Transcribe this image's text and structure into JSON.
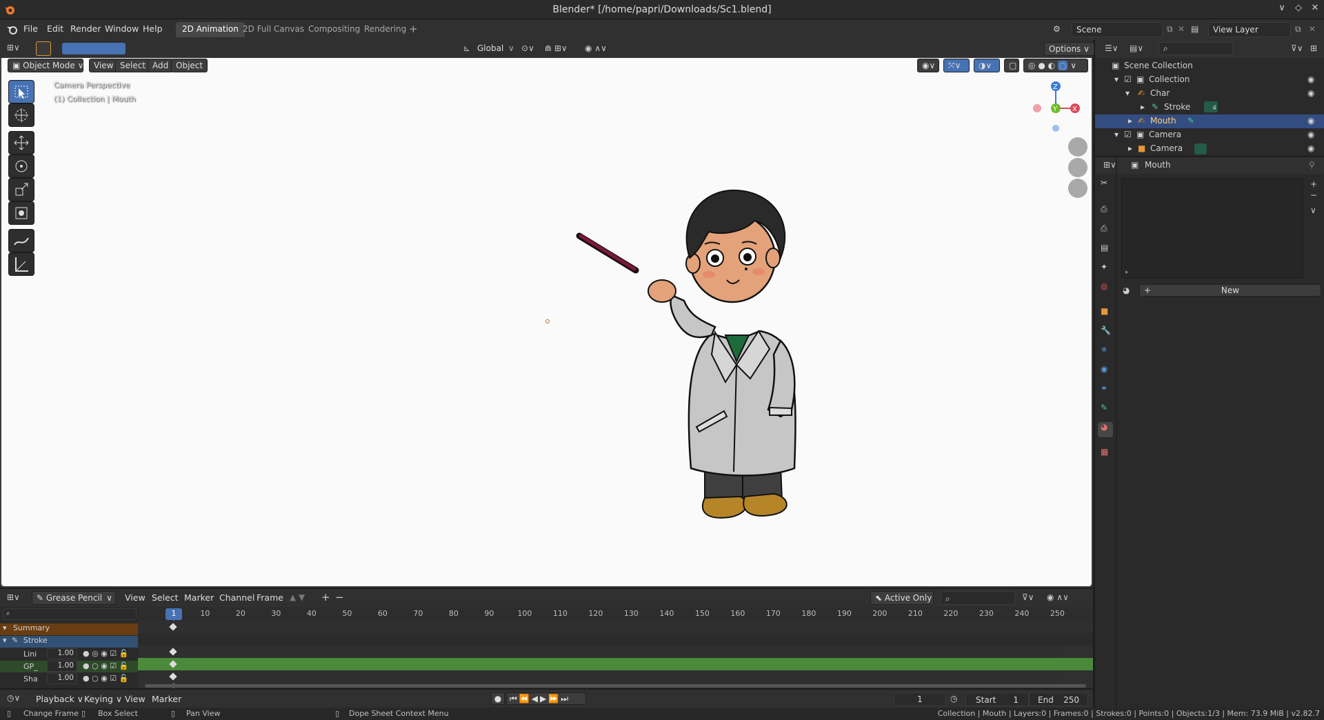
{
  "window": {
    "title": "Blender* [/home/papri/Downloads/Sc1.blend]",
    "controls": [
      "∨",
      "◇",
      "✕"
    ]
  },
  "menubar": {
    "menus": [
      "File",
      "Edit",
      "Render",
      "Window",
      "Help"
    ],
    "workspaces": [
      "2D Animation",
      "2D Full Canvas",
      "Compositing",
      "Rendering"
    ],
    "add_workspace": "+",
    "scene": "Scene",
    "view_layer": "View Layer"
  },
  "header3d": {
    "transform_orientation": "Global",
    "options": "Options ∨"
  },
  "viewport_header": {
    "mode": "Object Mode",
    "menus": [
      "View",
      "Select",
      "Add",
      "Object"
    ]
  },
  "viewport": {
    "perspective": "Camera Perspective",
    "collection_info": "(1) Collection | Mouth",
    "gizmo_axes": {
      "z": "Z",
      "y": "Y",
      "x": "X"
    }
  },
  "dopesheet": {
    "mode": "Grease Pencil",
    "menus": [
      "View",
      "Select",
      "Marker",
      "Channel",
      "Frame"
    ],
    "active_only": "Active Only",
    "current_frame": "1",
    "ruler": [
      "10",
      "20",
      "30",
      "40",
      "50",
      "60",
      "70",
      "80",
      "90",
      "100",
      "110",
      "120",
      "130",
      "140",
      "150",
      "160",
      "170",
      "180",
      "190",
      "200",
      "210",
      "220",
      "230",
      "240",
      "250"
    ],
    "channels": [
      {
        "name": "Summary",
        "type": "summary"
      },
      {
        "name": "Stroke",
        "type": "object"
      },
      {
        "name": "Lini",
        "value": "1.00",
        "type": "layer"
      },
      {
        "name": "GP_",
        "value": "1.00",
        "type": "layer"
      },
      {
        "name": "Sha",
        "value": "1.00",
        "type": "layer"
      }
    ]
  },
  "timeline": {
    "menus": [
      "Playback ∨",
      "Keying ∨",
      "View",
      "Marker"
    ],
    "frame": "1",
    "start_label": "Start",
    "start": "1",
    "end_label": "End",
    "end": "250"
  },
  "outliner": {
    "items": [
      {
        "label": "Scene Collection",
        "level": 0
      },
      {
        "label": "Collection",
        "level": 1
      },
      {
        "label": "Char",
        "level": 2
      },
      {
        "label": "Stroke",
        "level": 3
      },
      {
        "label": "Mouth",
        "level": 2
      },
      {
        "label": "Camera",
        "level": 1
      },
      {
        "label": "Camera",
        "level": 2
      }
    ],
    "badge": "4"
  },
  "properties": {
    "object_name": "Mouth",
    "new_button": "New"
  },
  "statusbar": {
    "hints": [
      "Change Frame",
      "Box Select",
      "Pan View",
      "Dope Sheet Context Menu"
    ],
    "stats": "Collection | Mouth | Layers:0 | Frames:0 | Strokes:0 | Points:0 | Objects:1/3 | Mem: 73.9 MiB | v2.82.7"
  },
  "colors": {
    "accent": "#4772b3",
    "selection": "#334d80",
    "keyframe_bar": "#4b8a3a",
    "summary": "#693d12"
  }
}
